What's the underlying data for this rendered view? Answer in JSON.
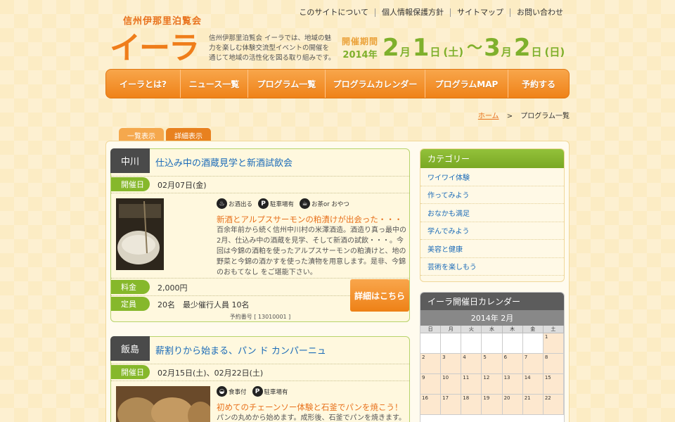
{
  "header": {
    "logo_sub": "信州伊那里泊覧会",
    "logo_main": "イーラ",
    "intro": "信州伊那里泊覧会 イーラでは、地域の魅力を楽しむ体験交流型イベントの開催を通じて地域の活性化を図る取り組みです。",
    "top_links": [
      "このサイトについて",
      "個人情報保護方針",
      "サイトマップ",
      "お問い合わせ"
    ],
    "period": {
      "label": "開催期間",
      "year": "2014年",
      "start_month": "2",
      "start_month_unit": "月",
      "start_day": "1",
      "start_day_unit": "日",
      "start_dow": "(土)",
      "tilde": "〜",
      "end_month": "3",
      "end_month_unit": "月",
      "end_day": "2",
      "end_day_unit": "日",
      "end_dow": "(日)"
    }
  },
  "nav": [
    "イーラとは?",
    "ニュース一覧",
    "プログラム一覧",
    "プログラムカレンダー",
    "プログラムMAP",
    "予約する"
  ],
  "breadcrumb": {
    "home": "ホーム",
    "sep": ">",
    "current": "プログラム一覧"
  },
  "tabs": {
    "list": "一覧表示",
    "detail": "詳細表示"
  },
  "programs": [
    {
      "area": "中川",
      "title": "仕込み中の酒蔵見学と新酒試飲会",
      "date_label": "開催日",
      "date": "02月07日(金)",
      "icons": [
        "お酒出る",
        "駐車場有",
        "お茶or おやつ"
      ],
      "catch": "新酒とアルプスサーモンの粕漬けが出会った・・・",
      "desc": "百余年前から続く信州中川村の米澤酒造。酒造り真っ最中の2月、仕込み中の酒蔵を見学、そして新酒の試飲・・・。今回は今錦の酒粕を使ったアルプスサーモンの粕漬けと、地の野菜と今錦の酒かすを使った漬物を用意します。是非、今錦のおもてなし をご堪能下さい。",
      "fee_label": "料金",
      "fee": "2,000円",
      "cap_label": "定員",
      "capacity": "20名　最少催行人員 10名",
      "detail_btn": "詳細はこちら",
      "resnum": "予約番号 [ 13010001 ]"
    },
    {
      "area": "飯島",
      "title": "薪割りから始まる、パン ド カンパーニュ",
      "date_label": "開催日",
      "date": "02月15日(土)、02月22日(土)",
      "icons": [
        "食事付",
        "駐車場有"
      ],
      "catch": "初めてのチェーンソー体験と石釜でパンを焼こう！",
      "desc": "パンの丸めから始めます。成形後、石釜でパンを焼きます。"
    }
  ],
  "sidebar": {
    "category_title": "カテゴリー",
    "categories": [
      "ワイワイ体験",
      "作ってみよう",
      "おなかも満足",
      "学んでみよう",
      "美容と健康",
      "芸術を楽しもう"
    ],
    "calendar_title": "イーラ開催日カレンダー",
    "calendar_month": "2014年 2月",
    "dow": [
      "日",
      "月",
      "火",
      "水",
      "木",
      "金",
      "土"
    ],
    "week1": [
      "",
      "",
      "",
      "",
      "",
      "",
      "1"
    ],
    "week2": [
      "2",
      "3",
      "4",
      "5",
      "6",
      "7",
      "8"
    ],
    "week3": [
      "9",
      "10",
      "11",
      "12",
      "13",
      "14",
      "15"
    ],
    "week4": [
      "16",
      "17",
      "18",
      "19",
      "20",
      "21",
      "22"
    ]
  },
  "colors": {
    "orange": "#ef8218",
    "green": "#86b82b",
    "link": "#1b6bb8"
  }
}
